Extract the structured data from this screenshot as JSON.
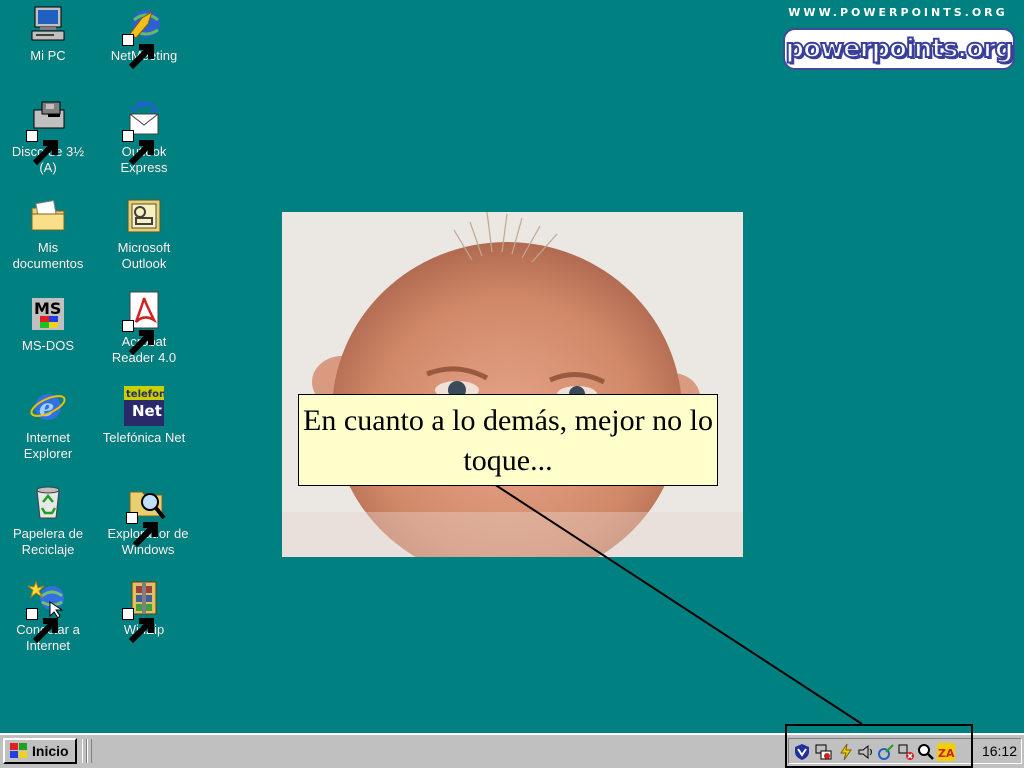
{
  "branding": {
    "url_text": "WWW.POWERPOINTS.ORG",
    "logo_text": "powerpoints.org"
  },
  "desktop_icons": [
    {
      "label": "Mi PC",
      "icon": "my-computer-icon"
    },
    {
      "label": "NetMeeting",
      "icon": "netmeeting-icon"
    },
    {
      "label": "Disco de 3½ (A)",
      "icon": "floppy-drive-icon"
    },
    {
      "label": "Outlook Express",
      "icon": "outlook-express-icon"
    },
    {
      "label": "Mis documentos",
      "icon": "folder-icon"
    },
    {
      "label": "Microsoft Outlook",
      "icon": "microsoft-outlook-icon"
    },
    {
      "label": "MS-DOS",
      "icon": "ms-dos-icon"
    },
    {
      "label": "Acrobat Reader 4.0",
      "icon": "acrobat-reader-icon"
    },
    {
      "label": "Internet Explorer",
      "icon": "internet-explorer-icon"
    },
    {
      "label": "Telefónica Net",
      "icon": "telefonica-net-icon"
    },
    {
      "label": "Papelera de Reciclaje",
      "icon": "recycle-bin-icon"
    },
    {
      "label": "Explorador de Windows",
      "icon": "windows-explorer-icon"
    },
    {
      "label": "Conectar a Internet",
      "icon": "connect-internet-icon"
    },
    {
      "label": "WinZip",
      "icon": "winzip-icon"
    }
  ],
  "telefonica_icon_text": {
    "top": "telefon",
    "bottom": "Net"
  },
  "msdos_icon_text": "MS",
  "callout": {
    "text": "En cuanto a lo demás, mejor no lo toque..."
  },
  "taskbar": {
    "start_label": "Inicio",
    "clock": "16:12",
    "tray_icons": [
      "shield-icon",
      "network-icon",
      "power-icon",
      "volume-icon",
      "link-icon",
      "settings-icon",
      "search-icon",
      "zonealarm-icon"
    ],
    "zonealarm_text": "ZA"
  },
  "colors": {
    "desktop": "#008080",
    "taskbar": "#c0c0c0",
    "callout_bg": "#ffffcc"
  }
}
